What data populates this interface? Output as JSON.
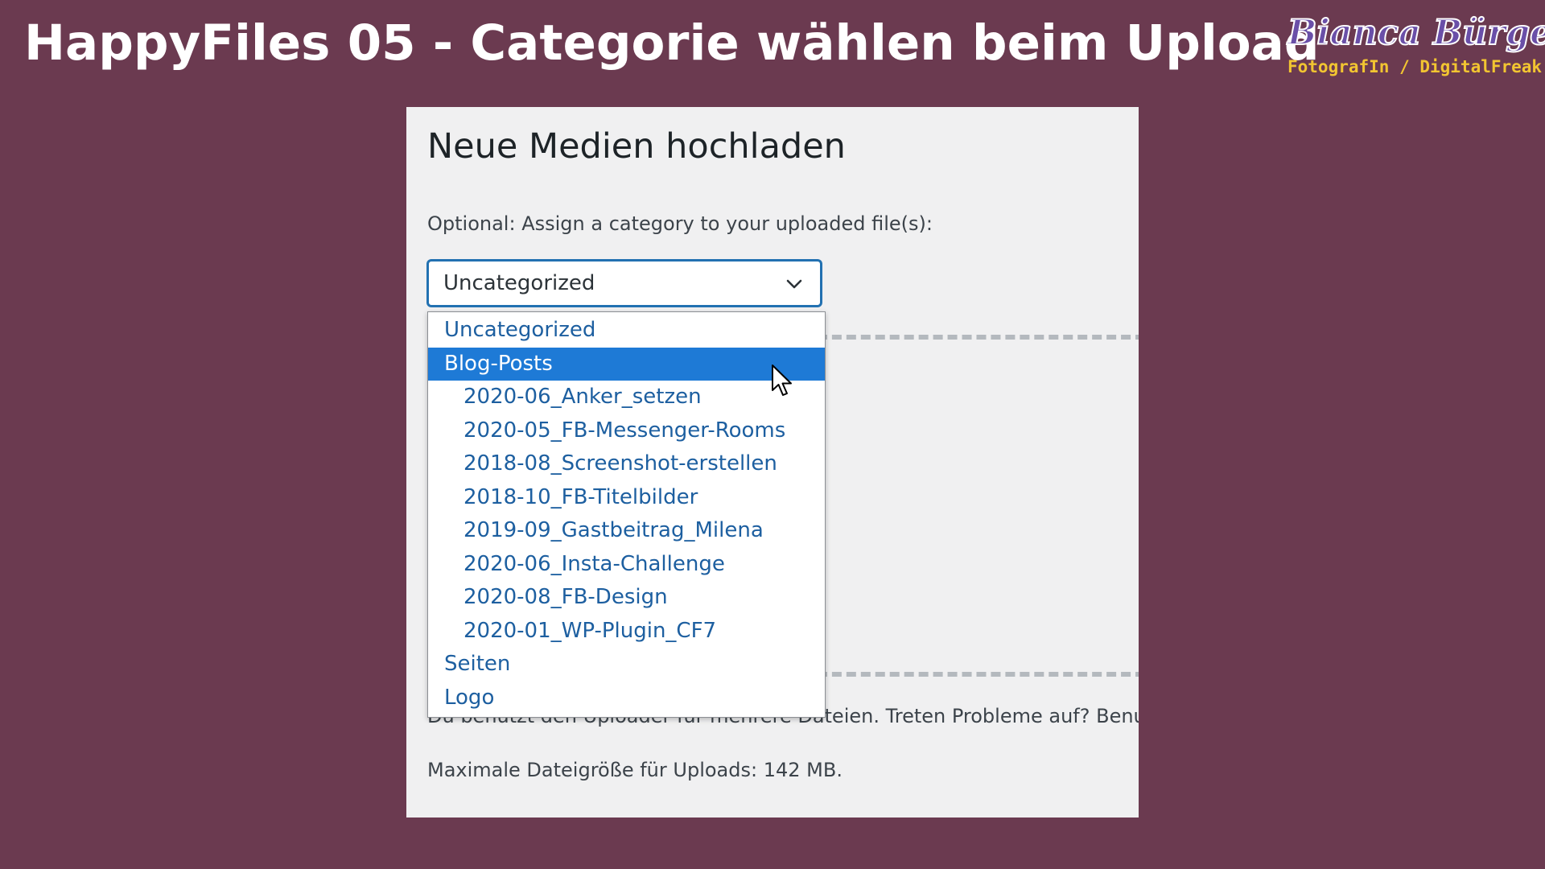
{
  "banner": {
    "title": "HappyFiles 05 - Categorie wählen beim Upload",
    "brand_name": "Bianca Bürger",
    "brand_tagline": "FotografIn / DigitalFreak"
  },
  "upload_page": {
    "heading": "Neue Medien hochladen",
    "category_label": "Optional: Assign a category to your uploaded file(s):",
    "category_select": {
      "value": "Uncategorized",
      "icon": "chevron-down-icon",
      "open": true
    },
    "uploader_note": "Du benutzt den Uploader für mehrere Dateien. Treten Probleme auf? Benut",
    "max_size": "Maximale Dateigröße für Uploads: 142 MB."
  },
  "dropdown": {
    "highlighted": "Blog-Posts",
    "options": [
      {
        "label": "Uncategorized",
        "level": 0
      },
      {
        "label": "Blog-Posts",
        "level": 0
      },
      {
        "label": "2020-06_Anker_setzen",
        "level": 1
      },
      {
        "label": "2020-05_FB-Messenger-Rooms",
        "level": 1
      },
      {
        "label": "2018-08_Screenshot-erstellen",
        "level": 1
      },
      {
        "label": "2018-10_FB-Titelbilder",
        "level": 1
      },
      {
        "label": "2019-09_Gastbeitrag_Milena",
        "level": 1
      },
      {
        "label": "2020-06_Insta-Challenge",
        "level": 1
      },
      {
        "label": "2020-08_FB-Design",
        "level": 1
      },
      {
        "label": "2020-01_WP-Plugin_CF7",
        "level": 1
      },
      {
        "label": "Seiten",
        "level": 0
      },
      {
        "label": "Logo",
        "level": 0
      }
    ]
  },
  "colors": {
    "background": "#6b3a50",
    "panel": "#f0f0f1",
    "highlight": "#1e7ad6",
    "option_text": "#1d5fa0",
    "brand_name": "#6a4fa8",
    "brand_tagline": "#f2c531"
  },
  "cursor": {
    "icon": "mouse-pointer-icon"
  }
}
